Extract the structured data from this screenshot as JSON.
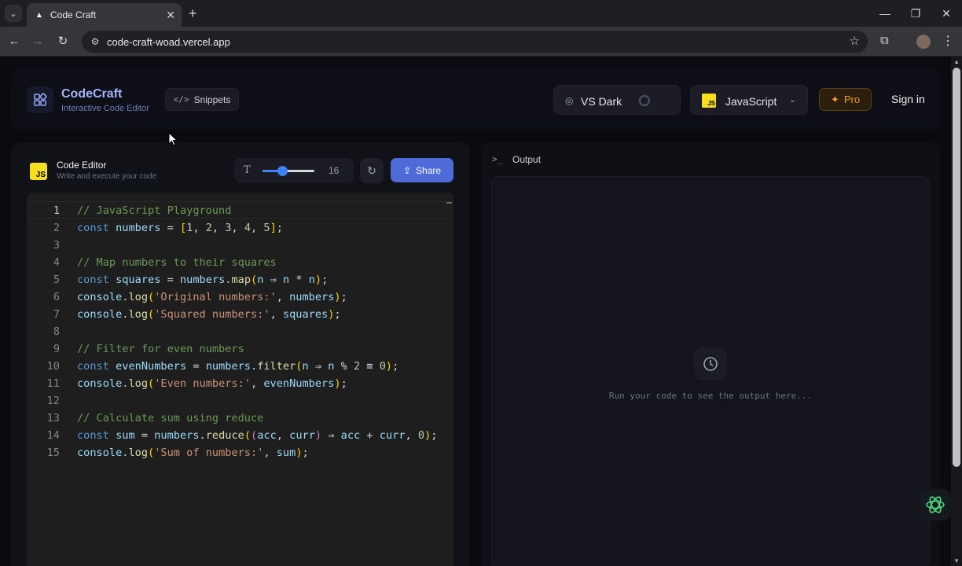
{
  "browser": {
    "tab_title": "Code Craft",
    "url": "code-craft-woad.vercel.app",
    "icons": [
      "tab-search-icon",
      "favicon-icon",
      "close-icon",
      "plus-icon",
      "minimize-icon",
      "maximize-icon",
      "close-window-icon",
      "back-icon",
      "forward-icon",
      "reload-icon",
      "site-info-icon",
      "star-icon",
      "extensions-icon",
      "profile-icon",
      "kebab-icon"
    ]
  },
  "header": {
    "brand": "CodeCraft",
    "tagline": "Interactive Code Editor",
    "snippets_label": "Snippets",
    "theme_label": "VS Dark",
    "language_badge": "JS",
    "language_label": "JavaScript",
    "pro_label": "Pro",
    "signin_label": "Sign in"
  },
  "editor": {
    "title": "Code Editor",
    "subtitle": "Write and execute your code",
    "language_badge": "JS",
    "font_size": "16",
    "font_slider_fraction": 0.38,
    "share_label": "Share",
    "active_line": 1,
    "lines": [
      {
        "n": "1",
        "tokens": [
          [
            "com",
            "// JavaScript Playground"
          ]
        ]
      },
      {
        "n": "2",
        "tokens": [
          [
            "kw",
            "const"
          ],
          [
            "id",
            " "
          ],
          [
            "var",
            "numbers"
          ],
          [
            "id",
            " = "
          ],
          [
            "b1",
            "["
          ],
          [
            "num",
            "1"
          ],
          [
            "id",
            ", "
          ],
          [
            "num",
            "2"
          ],
          [
            "id",
            ", "
          ],
          [
            "num",
            "3"
          ],
          [
            "id",
            ", "
          ],
          [
            "num",
            "4"
          ],
          [
            "id",
            ", "
          ],
          [
            "num",
            "5"
          ],
          [
            "b1",
            "]"
          ],
          [
            "id",
            ";"
          ]
        ]
      },
      {
        "n": "3",
        "tokens": []
      },
      {
        "n": "4",
        "tokens": [
          [
            "com",
            "// Map numbers to their squares"
          ]
        ]
      },
      {
        "n": "5",
        "tokens": [
          [
            "kw",
            "const"
          ],
          [
            "id",
            " "
          ],
          [
            "var",
            "squares"
          ],
          [
            "id",
            " = "
          ],
          [
            "var",
            "numbers"
          ],
          [
            "id",
            "."
          ],
          [
            "fn",
            "map"
          ],
          [
            "b1",
            "("
          ],
          [
            "var",
            "n"
          ],
          [
            "id",
            " ⇒ "
          ],
          [
            "var",
            "n"
          ],
          [
            "id",
            " * "
          ],
          [
            "var",
            "n"
          ],
          [
            "b1",
            ")"
          ],
          [
            "id",
            ";"
          ]
        ]
      },
      {
        "n": "6",
        "tokens": [
          [
            "var",
            "console"
          ],
          [
            "id",
            "."
          ],
          [
            "fn",
            "log"
          ],
          [
            "b1",
            "("
          ],
          [
            "str",
            "'Original numbers:'"
          ],
          [
            "id",
            ", "
          ],
          [
            "var",
            "numbers"
          ],
          [
            "b1",
            ")"
          ],
          [
            "id",
            ";"
          ]
        ]
      },
      {
        "n": "7",
        "tokens": [
          [
            "var",
            "console"
          ],
          [
            "id",
            "."
          ],
          [
            "fn",
            "log"
          ],
          [
            "b1",
            "("
          ],
          [
            "str",
            "'Squared numbers:'"
          ],
          [
            "id",
            ", "
          ],
          [
            "var",
            "squares"
          ],
          [
            "b1",
            ")"
          ],
          [
            "id",
            ";"
          ]
        ]
      },
      {
        "n": "8",
        "tokens": []
      },
      {
        "n": "9",
        "tokens": [
          [
            "com",
            "// Filter for even numbers"
          ]
        ]
      },
      {
        "n": "10",
        "tokens": [
          [
            "kw",
            "const"
          ],
          [
            "id",
            " "
          ],
          [
            "var",
            "evenNumbers"
          ],
          [
            "id",
            " = "
          ],
          [
            "var",
            "numbers"
          ],
          [
            "id",
            "."
          ],
          [
            "fn",
            "filter"
          ],
          [
            "b1",
            "("
          ],
          [
            "var",
            "n"
          ],
          [
            "id",
            " ⇒ "
          ],
          [
            "var",
            "n"
          ],
          [
            "id",
            " % "
          ],
          [
            "num",
            "2"
          ],
          [
            "id",
            " ≡ "
          ],
          [
            "num",
            "0"
          ],
          [
            "b1",
            ")"
          ],
          [
            "id",
            ";"
          ]
        ]
      },
      {
        "n": "11",
        "tokens": [
          [
            "var",
            "console"
          ],
          [
            "id",
            "."
          ],
          [
            "fn",
            "log"
          ],
          [
            "b1",
            "("
          ],
          [
            "str",
            "'Even numbers:'"
          ],
          [
            "id",
            ", "
          ],
          [
            "var",
            "evenNumbers"
          ],
          [
            "b1",
            ")"
          ],
          [
            "id",
            ";"
          ]
        ]
      },
      {
        "n": "12",
        "tokens": []
      },
      {
        "n": "13",
        "tokens": [
          [
            "com",
            "// Calculate sum using reduce"
          ]
        ]
      },
      {
        "n": "14",
        "tokens": [
          [
            "kw",
            "const"
          ],
          [
            "id",
            " "
          ],
          [
            "var",
            "sum"
          ],
          [
            "id",
            " = "
          ],
          [
            "var",
            "numbers"
          ],
          [
            "id",
            "."
          ],
          [
            "fn",
            "reduce"
          ],
          [
            "b1",
            "("
          ],
          [
            "b2",
            "("
          ],
          [
            "var",
            "acc"
          ],
          [
            "id",
            ", "
          ],
          [
            "var",
            "curr"
          ],
          [
            "b2",
            ")"
          ],
          [
            "id",
            " ⇒ "
          ],
          [
            "var",
            "acc"
          ],
          [
            "id",
            " + "
          ],
          [
            "var",
            "curr"
          ],
          [
            "id",
            ", "
          ],
          [
            "num",
            "0"
          ],
          [
            "b1",
            ")"
          ],
          [
            "id",
            ";"
          ]
        ]
      },
      {
        "n": "15",
        "tokens": [
          [
            "var",
            "console"
          ],
          [
            "id",
            "."
          ],
          [
            "fn",
            "log"
          ],
          [
            "b1",
            "("
          ],
          [
            "str",
            "'Sum of numbers:'"
          ],
          [
            "id",
            ", "
          ],
          [
            "var",
            "sum"
          ],
          [
            "b1",
            ")"
          ],
          [
            "id",
            ";"
          ]
        ]
      }
    ]
  },
  "output": {
    "title": "Output",
    "placeholder": "Run your code to see the output here..."
  },
  "colors": {
    "accent": "#4f6bd8",
    "brand": "#a5b4fc",
    "pro": "#f59e0b",
    "js_yellow": "#f7df1e"
  }
}
